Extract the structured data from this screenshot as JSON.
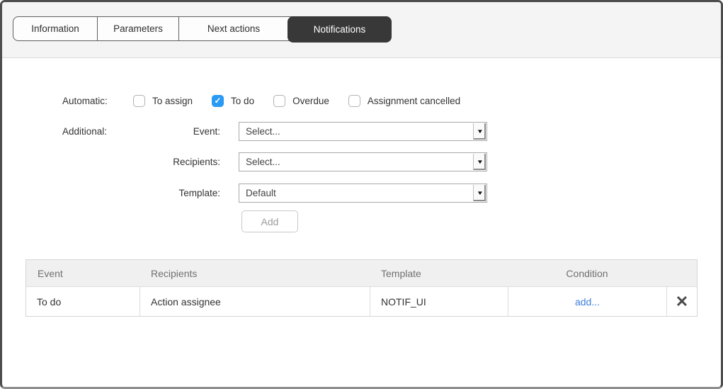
{
  "tabs": [
    {
      "label": "Information",
      "active": false
    },
    {
      "label": "Parameters",
      "active": false
    },
    {
      "label": "Next actions",
      "active": false
    },
    {
      "label": "Notifications",
      "active": true
    }
  ],
  "form": {
    "automatic_label": "Automatic:",
    "additional_label": "Additional:",
    "checkboxes": [
      {
        "label": "To assign",
        "checked": false
      },
      {
        "label": "To do",
        "checked": true
      },
      {
        "label": "Overdue",
        "checked": false
      },
      {
        "label": "Assignment cancelled",
        "checked": false
      }
    ],
    "fields": [
      {
        "label": "Event:",
        "value": "Select..."
      },
      {
        "label": "Recipients:",
        "value": "Select..."
      },
      {
        "label": "Template:",
        "value": "Default"
      }
    ],
    "add_button_label": "Add"
  },
  "table": {
    "headers": [
      "Event",
      "Recipients",
      "Template",
      "Condition"
    ],
    "rows": [
      {
        "event": "To do",
        "recipients": "Action assignee",
        "template": "NOTIF_UI",
        "condition_link": "add..."
      }
    ]
  },
  "icons": {
    "check_glyph": "✓",
    "dropdown_arrow": "▼",
    "delete_glyph": "✕"
  },
  "colors": {
    "active_tab_bg": "#383838",
    "checked_checkbox": "#2b9af3",
    "link_blue": "#3c7edd",
    "strip_bg": "#f4f4f4",
    "table_header_bg": "#f0f0f0"
  }
}
